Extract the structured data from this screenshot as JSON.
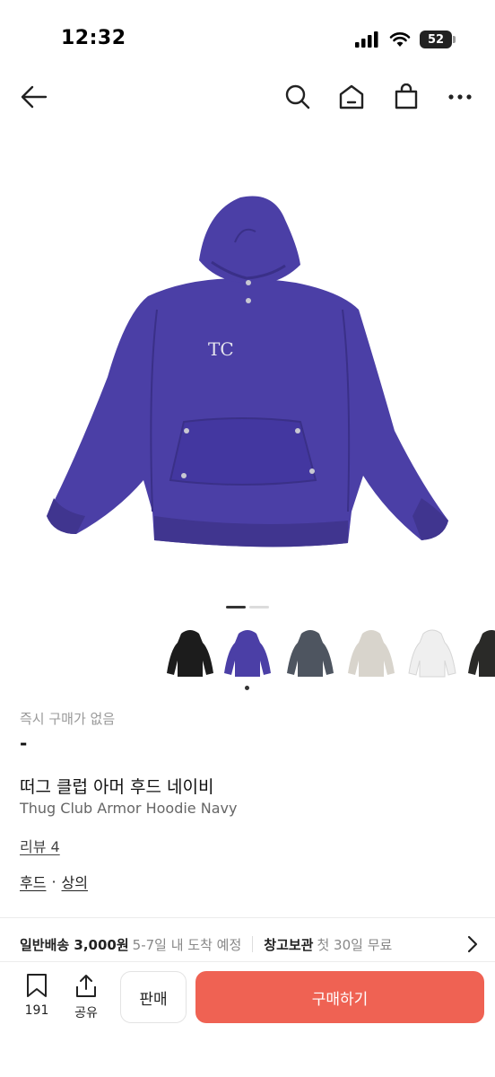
{
  "status_bar": {
    "time": "12:32",
    "battery": "52"
  },
  "nav": {
    "back_icon": "arrow-left-icon",
    "search_icon": "search-icon",
    "home_icon": "home-icon",
    "bag_icon": "shopping-bag-icon",
    "more_icon": "more-dots-icon"
  },
  "hero": {
    "logo_text": "TC"
  },
  "thumbnails": [
    {
      "color": "#1c1c1c"
    },
    {
      "color": "#4b3fa6"
    },
    {
      "color": "#4e5560"
    },
    {
      "color": "#d8d4cc"
    },
    {
      "color": "#efefef"
    },
    {
      "color": "#2a2a28"
    }
  ],
  "product": {
    "buy_now_text": "즉시 구매가 없음",
    "price_dash": "-",
    "title_ko": "떠그 클럽 아머 후드 네이비",
    "title_en": "Thug Club Armor Hoodie Navy",
    "review_link": "리뷰 4",
    "category_1": "후드",
    "category_sep": "·",
    "category_2": "상의"
  },
  "shipping": {
    "standard_label": "일반배송 3,000원",
    "standard_eta": "5-7일 내 도착 예정",
    "warehouse_label": "창고보관",
    "warehouse_note": "첫 30일 무료"
  },
  "bottom_bar": {
    "bookmark_count": "191",
    "share_label": "공유",
    "sell_label": "판매",
    "buy_label": "구매하기"
  },
  "colors": {
    "accent": "#ef6253",
    "hoodie": "#4b3fa6"
  }
}
